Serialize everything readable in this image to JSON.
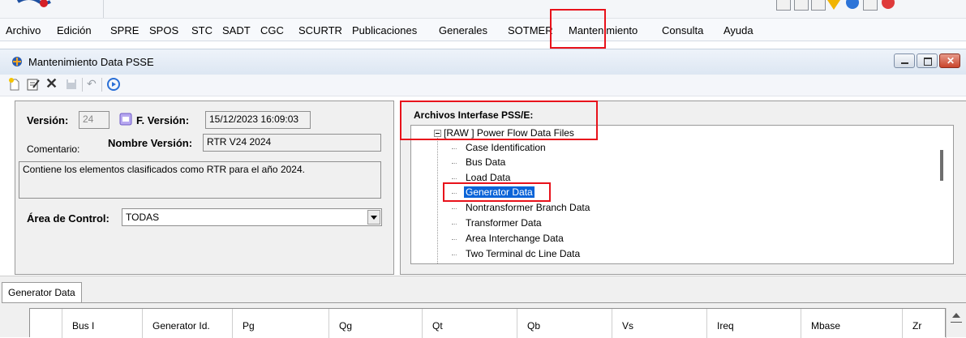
{
  "menu": {
    "items": [
      "Archivo",
      "Edición",
      "SPRE",
      "SPOS",
      "STC",
      "SADT",
      "CGC",
      "SCURTR",
      "Publicaciones",
      "Generales",
      "SOTMER",
      "Mantenimiento",
      "Consulta",
      "Ayuda"
    ]
  },
  "window": {
    "title": "Mantenimiento Data PSSE"
  },
  "version_panel": {
    "version_label": "Versión:",
    "version_value": "24",
    "fversion_label": "F. Versión:",
    "fversion_value": "15/12/2023 16:09:03",
    "comentario_label": "Comentario:",
    "nombre_label": "Nombre Versión:",
    "nombre_value": "RTR V24 2024",
    "comentario_value": "Contiene los elementos clasificados como RTR para el año 2024.",
    "area_label": "Área de Control:",
    "area_value": "TODAS"
  },
  "tree_panel": {
    "title": "Archivos Interfase PSS/E:",
    "root": "[RAW ] Power Flow Data Files",
    "children": [
      "Case Identification",
      "Bus Data",
      "Load Data",
      "Generator Data",
      "Nontransformer Branch Data",
      "Transformer Data",
      "Area Interchange Data",
      "Two Terminal dc Line Data"
    ],
    "selected": "Generator Data"
  },
  "bottom_tab": {
    "label": "Generator Data"
  },
  "grid": {
    "columns": [
      "",
      "Bus I",
      "Generator Id.",
      "Pg",
      "Qg",
      "Qt",
      "Qb",
      "Vs",
      "Ireq",
      "Mbase",
      "Zr"
    ]
  },
  "colors": {
    "highlight": "#e8121b",
    "selection": "#0a64d8",
    "menu_bg": "#f7f9fc"
  }
}
